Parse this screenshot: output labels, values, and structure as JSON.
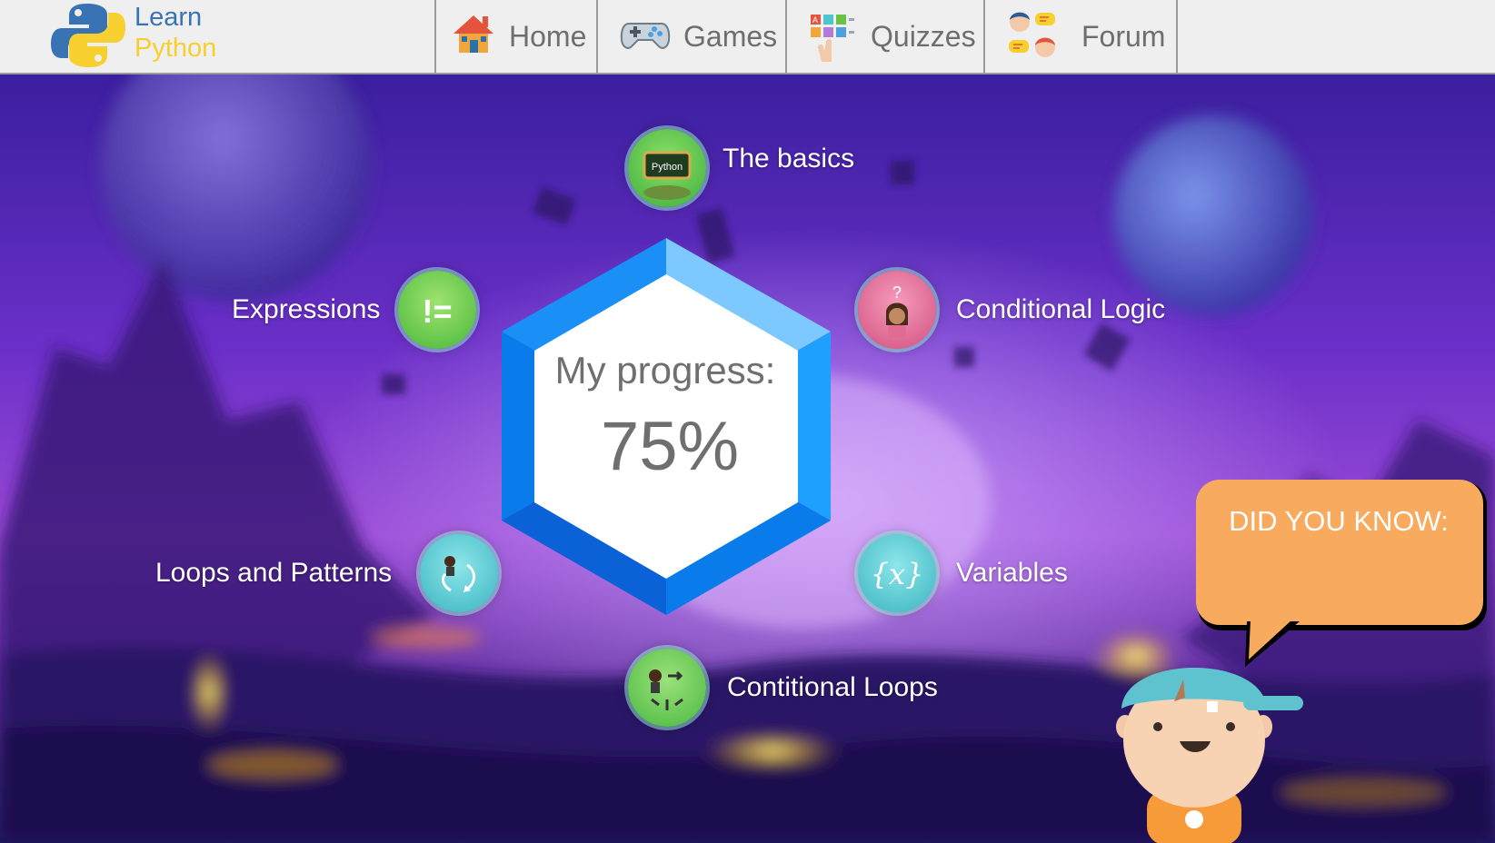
{
  "app": {
    "logo_line1": "Learn",
    "logo_line2": "Python",
    "colors": {
      "logo_blue": "#3a73b3",
      "logo_yellow": "#f7cf2f",
      "nav_text": "#6e6e6e"
    }
  },
  "nav": {
    "items": [
      {
        "label": "Home",
        "icon": "house-icon"
      },
      {
        "label": "Games",
        "icon": "gamepad-icon"
      },
      {
        "label": "Quizzes",
        "icon": "quiz-cards-icon"
      },
      {
        "label": "Forum",
        "icon": "chat-people-icon"
      }
    ]
  },
  "progress": {
    "title": "My progress:",
    "value_text": "75%",
    "value": 0.75,
    "colors": {
      "hex_light": "#7cc8ff",
      "hex_mid": "#1ea0ff",
      "hex_dark": "#0a62d6",
      "text": "#6f6f6f"
    }
  },
  "skills": [
    {
      "label": "The basics",
      "icon": "python-board-icon",
      "badge": "Python",
      "color": "#5fc94a"
    },
    {
      "label": "Conditional Logic",
      "icon": "girl-question-icon",
      "color": "#e06b93"
    },
    {
      "label": "Variables",
      "icon": "curly-x-icon",
      "glyph": "{x}",
      "color": "#4cc5cf"
    },
    {
      "label": "Contitional Loops",
      "icon": "character-arrows-icon",
      "color": "#63cc4f"
    },
    {
      "label": "Loops and Patterns",
      "icon": "loop-arrows-icon",
      "color": "#4cc5cf"
    },
    {
      "label": "Expressions",
      "icon": "not-equal-icon",
      "glyph": "!=",
      "color": "#67d246"
    }
  ],
  "tip": {
    "title": "DID YOU KNOW:",
    "body": "",
    "color": "#f8aa5e"
  }
}
